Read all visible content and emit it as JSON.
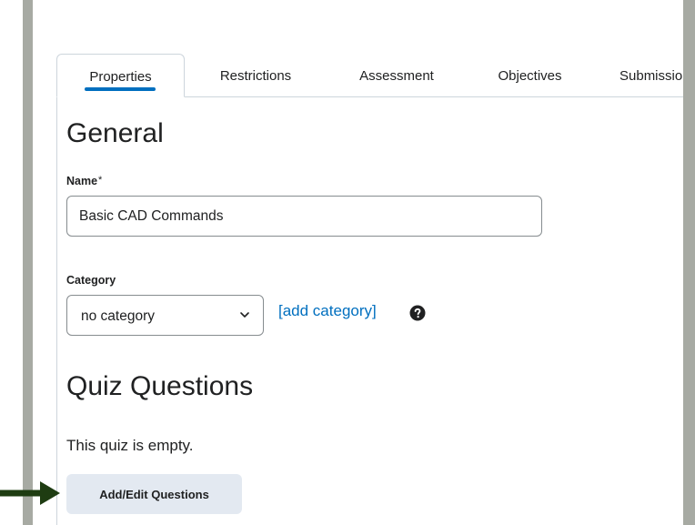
{
  "tabs": [
    {
      "label": "Properties",
      "active": true
    },
    {
      "label": "Restrictions",
      "active": false
    },
    {
      "label": "Assessment",
      "active": false
    },
    {
      "label": "Objectives",
      "active": false
    },
    {
      "label": "Submissions",
      "active": false
    }
  ],
  "general": {
    "heading": "General",
    "name_label": "Name",
    "required_mark": "*",
    "name_value": "Basic CAD Commands",
    "category_label": "Category",
    "category_selected": "no category",
    "add_category_link": "[add category]",
    "help_icon": "question-circle-icon"
  },
  "quiz_questions": {
    "heading": "Quiz Questions",
    "empty_text": "This quiz is empty.",
    "add_edit_button": "Add/Edit Questions"
  },
  "annotation": {
    "arrow_icon": "right-arrow-icon",
    "arrow_color": "#1e3c12"
  },
  "colors": {
    "accent": "#006fbf",
    "frame": "#a7aaa3",
    "button_bg": "#e3e9f1"
  }
}
